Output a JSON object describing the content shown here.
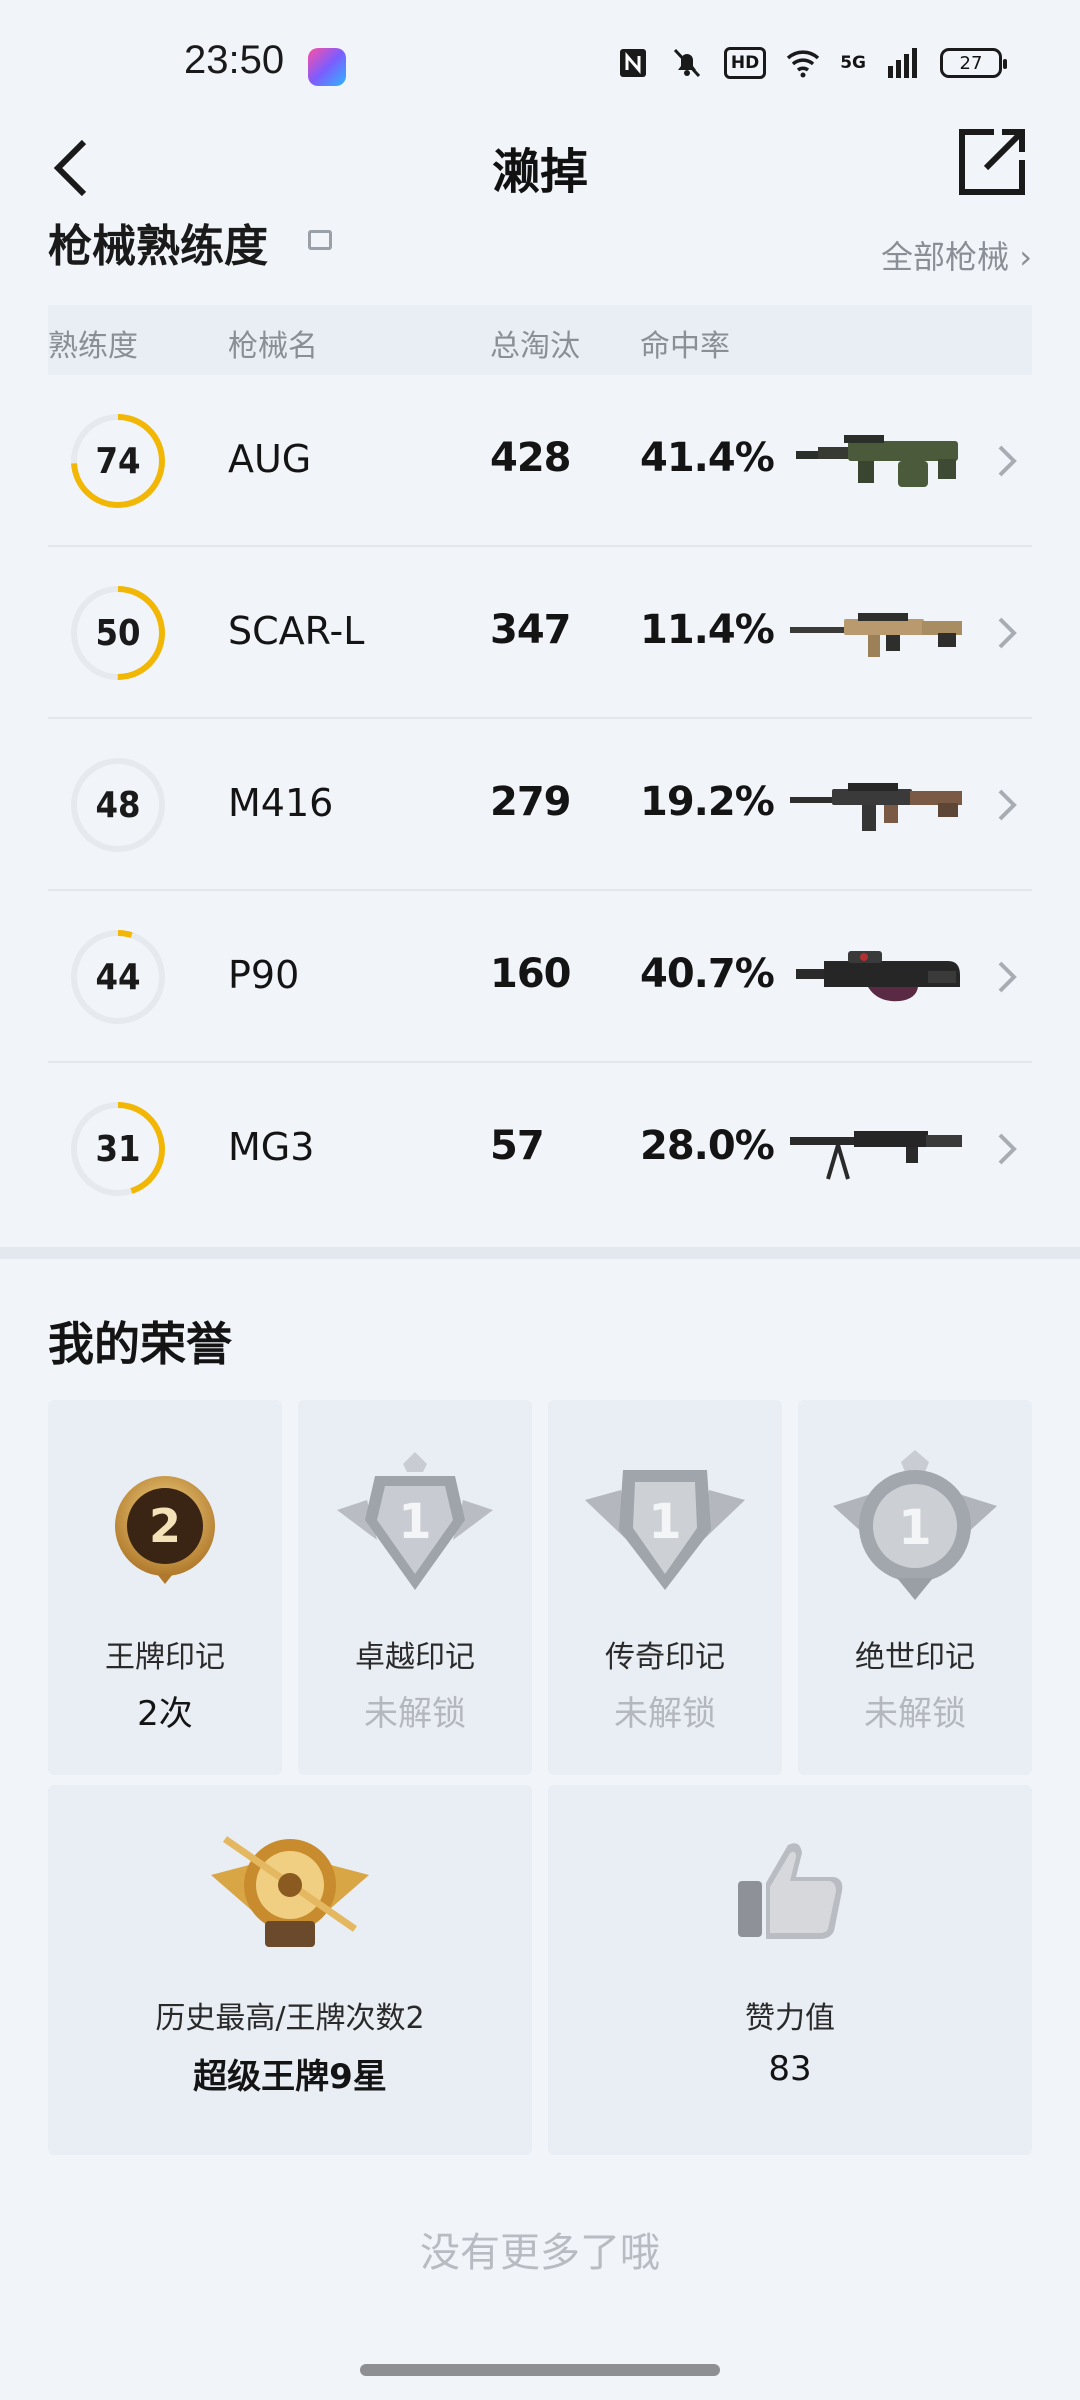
{
  "status_bar": {
    "time": "23:50",
    "battery": "27",
    "network": "5G"
  },
  "header": {
    "title": "濑掉"
  },
  "weapons_section": {
    "title": "枪械熟练度",
    "all_link": "全部枪械",
    "columns": {
      "proficiency": "熟练度",
      "name": "枪械名",
      "kills": "总淘汰",
      "accuracy": "命中率"
    },
    "rows": [
      {
        "proficiency": "74",
        "proficiency_fraction": 0.74,
        "name": "AUG",
        "kills": "428",
        "accuracy": "41.4%"
      },
      {
        "proficiency": "50",
        "proficiency_fraction": 0.5,
        "name": "SCAR-L",
        "kills": "347",
        "accuracy": "11.4%"
      },
      {
        "proficiency": "48",
        "proficiency_fraction": 0.0,
        "name": "M416",
        "kills": "279",
        "accuracy": "19.2%"
      },
      {
        "proficiency": "44",
        "proficiency_fraction": 0.05,
        "name": "P90",
        "kills": "160",
        "accuracy": "40.7%"
      },
      {
        "proficiency": "31",
        "proficiency_fraction": 0.45,
        "name": "MG3",
        "kills": "57",
        "accuracy": "28.0%"
      }
    ]
  },
  "honors_section": {
    "title": "我的荣誉",
    "marks": [
      {
        "label": "王牌印记",
        "value": "2次",
        "badge": "2"
      },
      {
        "label": "卓越印记",
        "value": "未解锁",
        "badge": "1"
      },
      {
        "label": "传奇印记",
        "value": "未解锁",
        "badge": "1"
      },
      {
        "label": "绝世印记",
        "value": "未解锁",
        "badge": "1"
      }
    ],
    "rank": {
      "label": "历史最高/王牌次数2",
      "value": "超级王牌9星"
    },
    "likes": {
      "label": "赞力值",
      "value": "83"
    }
  },
  "footer": {
    "no_more": "没有更多了哦"
  },
  "colors": {
    "ring_progress": "#f2b705",
    "ring_track": "#e6e9ee",
    "background": "#f1f5fa"
  }
}
